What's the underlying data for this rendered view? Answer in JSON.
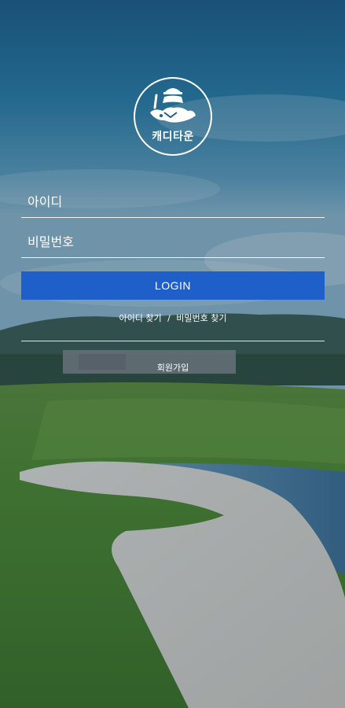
{
  "logo": {
    "brand_name": "캐디타운"
  },
  "login_form": {
    "id_placeholder": "아이디",
    "password_placeholder": "비밀번호",
    "login_label": "LOGIN"
  },
  "links": {
    "find_id": "아이디 찾기",
    "separator": "/",
    "find_password": "비밀번호 찾기",
    "signup": "회원가입"
  },
  "colors": {
    "login_button": "#1f5fc9",
    "text": "#ffffff"
  },
  "icons": [
    "caddie-logo-icon"
  ]
}
